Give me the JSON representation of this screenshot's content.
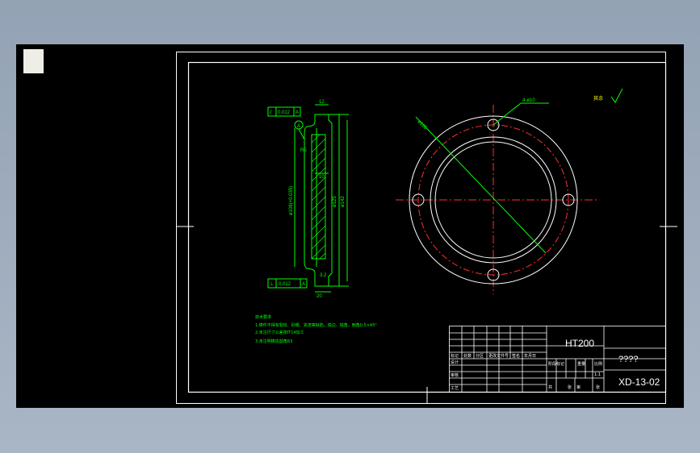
{
  "colors": {
    "frame": "#ffffff",
    "part": "#00ff00",
    "centerline": "#ff3030",
    "note": "#ffff00",
    "text": "#ffffff"
  },
  "drawing": {
    "tolerance_top": {
      "symbol": "⫽",
      "value": "0.012",
      "datum": "A"
    },
    "tolerance_bottom": {
      "symbol": "⊥",
      "value": "0.012",
      "datum": "A"
    },
    "datum_label": "A",
    "dim_top_width": "12",
    "dim_radius": "R5",
    "dim_mid": "10",
    "dim_bore": "ø106(+0.035)",
    "dim_d1": "ø125",
    "dim_d2": "ø142",
    "dim_chamfer": "3.2",
    "dim_bottom_width": "20",
    "dim_holes": "4-ø10",
    "dim_pcd": "ø126",
    "roughness_label": "其余"
  },
  "notes": {
    "title": "技术要求",
    "items": [
      "1.铸件不得有裂纹、砂眼、夹渣等缺陷，锐边、锐角，倒角0.5×45°",
      "2.未注尺寸公差按IT14加工",
      "3.未注明铸造圆角R3"
    ]
  },
  "title_block": {
    "material": "HT200",
    "part_name": "????",
    "drawing_no": "XD-13-02",
    "scale": "1:1",
    "row_labels": [
      "标记",
      "设计",
      "审核",
      "工艺"
    ],
    "header_labels": [
      "处数",
      "分区",
      "更改文件号",
      "签名",
      "年月日"
    ],
    "stage_labels": [
      "阶段标记",
      "重量",
      "比例"
    ],
    "sheet_labels": [
      "共",
      "张",
      "第",
      "张"
    ]
  }
}
